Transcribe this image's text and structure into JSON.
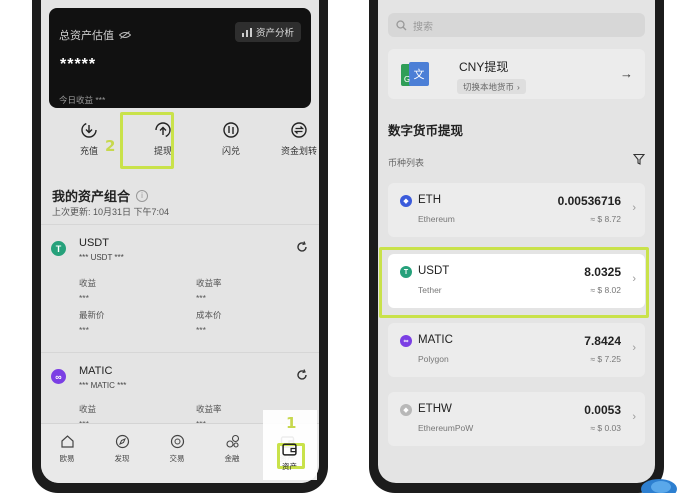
{
  "left_screen": {
    "asset_card": {
      "title": "总资产估值",
      "analysis_label": "资产分析",
      "masked_value": "*****",
      "today_label": "今日收益 ***"
    },
    "actions": [
      {
        "label": "充值",
        "icon": "deposit-icon"
      },
      {
        "label": "提现",
        "icon": "withdraw-icon"
      },
      {
        "label": "闪兑",
        "icon": "swap-icon"
      },
      {
        "label": "资金划转",
        "icon": "transfer-icon"
      }
    ],
    "step_labels": {
      "withdraw": "2",
      "assets_tab": "1"
    },
    "portfolio": {
      "title": "我的资产组合",
      "last_update": "上次更新: 10月31日 下午7:04"
    },
    "assets": [
      {
        "name": "USDT",
        "sub": "*** USDT ***",
        "fields": [
          {
            "label": "收益",
            "value": "***"
          },
          {
            "label": "收益率",
            "value": "***"
          },
          {
            "label": "最新价",
            "value": "***"
          },
          {
            "label": "成本价",
            "value": "***"
          }
        ]
      },
      {
        "name": "MATIC",
        "sub": "*** MATIC ***",
        "fields": [
          {
            "label": "收益",
            "value": "***"
          },
          {
            "label": "收益率",
            "value": "***"
          }
        ]
      }
    ],
    "tabs": [
      {
        "label": "欧易",
        "icon": "home-icon"
      },
      {
        "label": "发现",
        "icon": "discover-icon"
      },
      {
        "label": "交易",
        "icon": "trade-icon"
      },
      {
        "label": "金融",
        "icon": "finance-icon"
      },
      {
        "label": "资产",
        "icon": "wallet-icon"
      }
    ]
  },
  "right_screen": {
    "search": {
      "placeholder": "搜索"
    },
    "cny": {
      "title": "CNY提现",
      "switch_label": "切换本地货币"
    },
    "section_title": "数字货币提现",
    "list_label": "币种列表",
    "coins": [
      {
        "symbol": "ETH",
        "name": "Ethereum",
        "amount": "0.00536716",
        "value": "≈ $ 8.72",
        "color": "#3b5bdb",
        "glyph": "◆"
      },
      {
        "symbol": "USDT",
        "name": "Tether",
        "amount": "8.0325",
        "value": "≈ $ 8.02",
        "color": "#26a17b",
        "glyph": "T"
      },
      {
        "symbol": "MATIC",
        "name": "Polygon",
        "amount": "7.8424",
        "value": "≈ $ 7.25",
        "color": "#7b3fe4",
        "glyph": "∞"
      },
      {
        "symbol": "ETHW",
        "name": "EthereumPoW",
        "amount": "0.0053",
        "value": "≈ $ 0.03",
        "color": "#b8b8b8",
        "glyph": "◆"
      }
    ]
  },
  "colors": {
    "highlight": "#c9e24a",
    "tether": "#26a17b",
    "matic": "#7b3fe4"
  }
}
